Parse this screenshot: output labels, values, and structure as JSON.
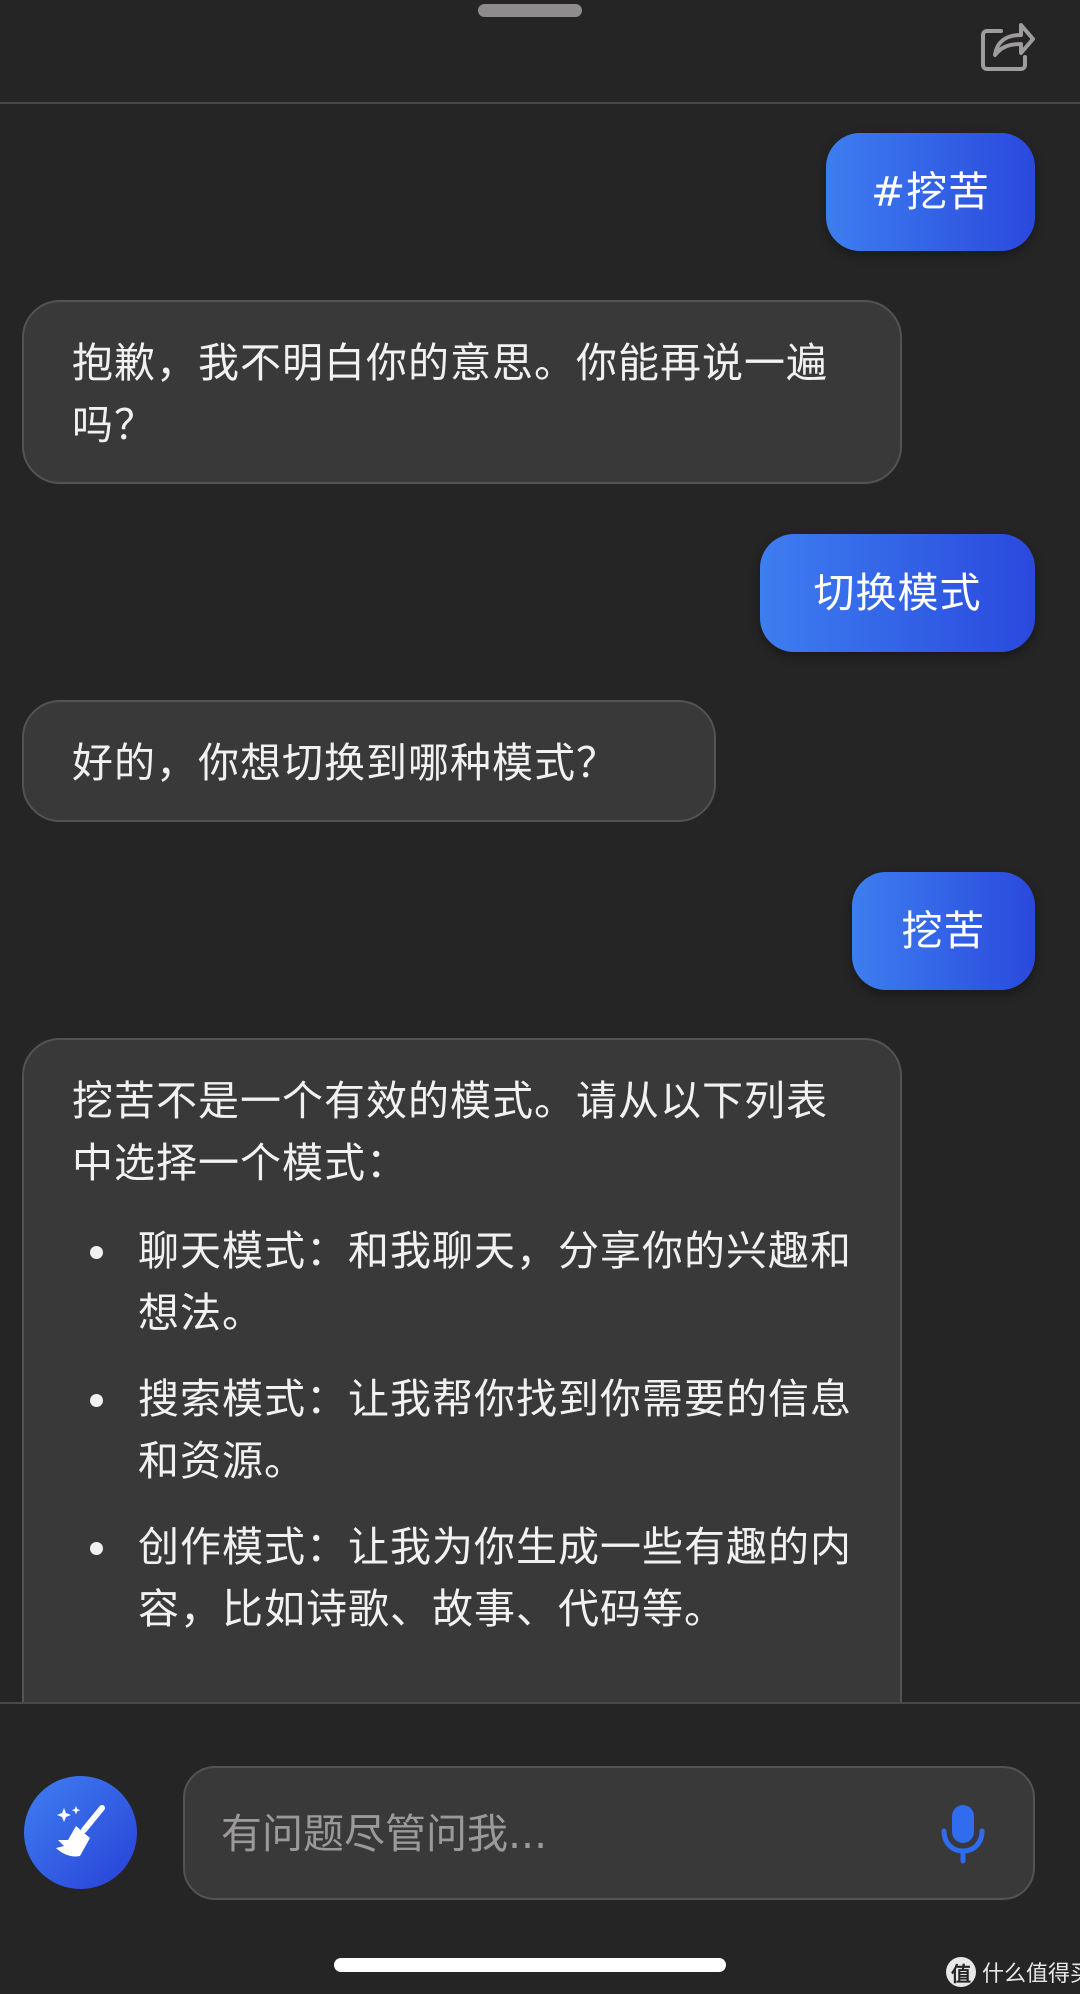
{
  "messages": [
    {
      "role": "user",
      "text": "#挖苦"
    },
    {
      "role": "assistant",
      "text": "抱歉，我不明白你的意思。你能再说一遍吗？"
    },
    {
      "role": "user",
      "text": "切换模式"
    },
    {
      "role": "assistant",
      "text": "好的，你想切换到哪种模式？"
    },
    {
      "role": "user",
      "text": "挖苦"
    },
    {
      "role": "assistant",
      "text": "挖苦不是一个有效的模式。请从以下列表中选择一个模式：",
      "list": [
        "聊天模式：和我聊天，分享你的兴趣和想法。",
        "搜索模式：让我帮你找到你需要的信息和资源。",
        "创作模式：让我为你生成一些有趣的内容，比如诗歌、故事、代码等。"
      ]
    }
  ],
  "input": {
    "placeholder": "有问题尽管问我..."
  },
  "icons": {
    "share": "share-icon",
    "broom": "broom-sparkle-icon",
    "mic": "microphone-icon"
  },
  "colors": {
    "accent": "#2f5fe6",
    "mic": "#2f6cf0",
    "background": "#262525",
    "bubble": "#3a3939"
  },
  "watermark": {
    "logo": "值",
    "text": "什么值得买"
  }
}
